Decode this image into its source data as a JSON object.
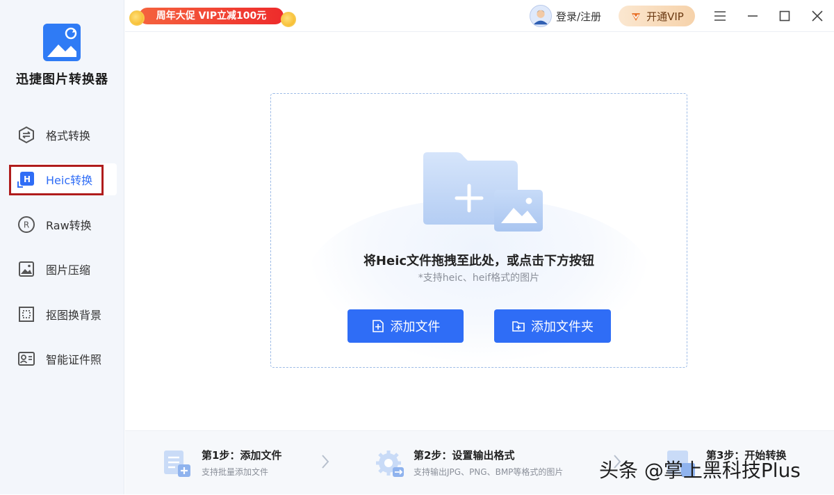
{
  "app": {
    "title": "迅捷图片转换器"
  },
  "promo": {
    "label": "周年大促 VIP立减100元"
  },
  "header": {
    "login_label": "登录/注册",
    "vip_label": "开通VIP"
  },
  "sidebar": {
    "items": [
      {
        "label": "格式转换",
        "icon": "format-convert-icon"
      },
      {
        "label": "Heic转换",
        "icon": "heic-icon",
        "active": true
      },
      {
        "label": "Raw转换",
        "icon": "raw-icon"
      },
      {
        "label": "图片压缩",
        "icon": "image-compress-icon"
      },
      {
        "label": "抠图换背景",
        "icon": "cutout-icon"
      },
      {
        "label": "智能证件照",
        "icon": "id-photo-icon"
      }
    ]
  },
  "dropzone": {
    "title": "将Heic文件拖拽至此处，或点击下方按钮",
    "subtitle": "*支持heic、heif格式的图片",
    "add_file_label": "添加文件",
    "add_folder_label": "添加文件夹"
  },
  "steps": [
    {
      "title": "第1步：添加文件",
      "desc": "支持批量添加文件"
    },
    {
      "title": "第2步：设置输出格式",
      "desc": "支持输出JPG、PNG、BMP等格式的图片"
    },
    {
      "title": "第3步：开始转换",
      "desc": ""
    }
  ],
  "watermark": "头条 @掌上黑科技Plus",
  "colors": {
    "accent": "#2f6df6",
    "highlight_frame": "#b01c1c",
    "promo": "#ee2b2b"
  }
}
